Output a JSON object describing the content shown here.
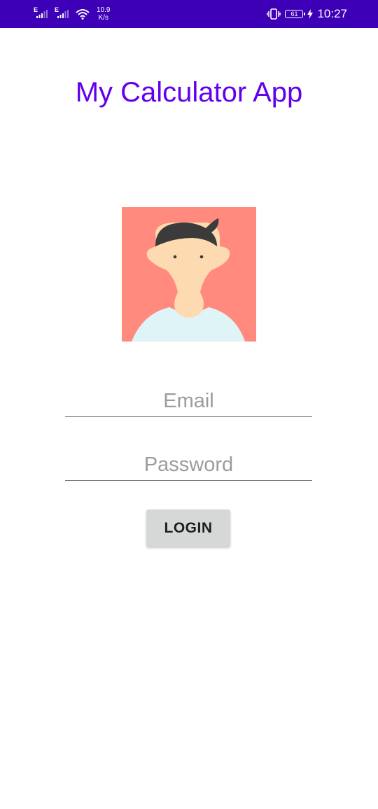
{
  "status_bar": {
    "sim1_label": "E",
    "sim2_label": "E",
    "net_speed_value": "10.9",
    "net_speed_unit": "K/s",
    "battery_level": "61",
    "time": "10:27",
    "icons": [
      "signal-icon",
      "signal-icon",
      "wifi-icon",
      "vibrate-icon",
      "battery-icon",
      "charging-icon"
    ]
  },
  "app": {
    "title": "My Calculator App"
  },
  "avatar": {
    "icon": "user-avatar-icon",
    "colors": {
      "background": "#ff8a7d",
      "skin": "#fddab0",
      "hair": "#3b3b3b",
      "shirt": "#def4f6"
    }
  },
  "form": {
    "email": {
      "value": "",
      "placeholder": "Email"
    },
    "password": {
      "value": "",
      "placeholder": "Password"
    },
    "login_label": "LOGIN"
  },
  "colors": {
    "status_bar": "#3d00b6",
    "title": "#6200ee",
    "button_bg": "#d6d7d7"
  }
}
